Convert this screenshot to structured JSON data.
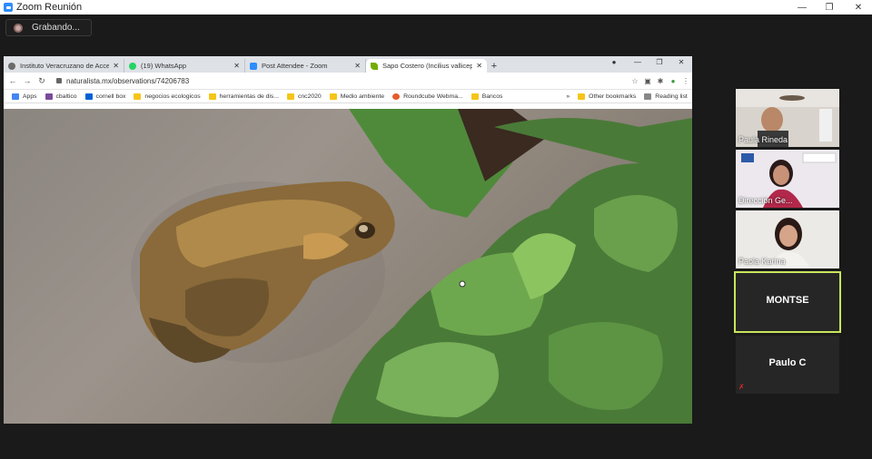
{
  "window": {
    "title": "Zoom Reunión",
    "minimize": "—",
    "restore": "❐",
    "close": "✕"
  },
  "recording": {
    "label": "Grabando..."
  },
  "browser": {
    "tabs": [
      {
        "title": "Instituto Veracruzano de Acceso",
        "favicon_color": "#6b6b6b"
      },
      {
        "title": "(19) WhatsApp",
        "favicon_color": "#25d366"
      },
      {
        "title": "Post Attendee - Zoom",
        "favicon_color": "#2d8cff"
      },
      {
        "title": "Sapo Costero (Incilius valliceps)",
        "favicon_color": "#74ac00"
      }
    ],
    "new_tab": "+",
    "address": "naturalista.mx/observations/74206783",
    "bookmarks": [
      {
        "label": "Apps",
        "color": "#4285f4"
      },
      {
        "label": "cbaltico",
        "color": "#7b4b9b"
      },
      {
        "label": "cornell box",
        "color": "#0061d5"
      },
      {
        "label": "negocios ecologicos",
        "color": "#f5c518"
      },
      {
        "label": "herramientas de dis...",
        "color": "#f5c518"
      },
      {
        "label": "cnc2020",
        "color": "#f5c518"
      },
      {
        "label": "Medio ambiente",
        "color": "#f5c518"
      },
      {
        "label": "Roundcube Webma...",
        "color": "#e55b2b"
      },
      {
        "label": "Bancos",
        "color": "#f5c518"
      }
    ],
    "more": "»",
    "other_bookmarks": "Other bookmarks",
    "reading_list": "Reading list"
  },
  "participants": [
    {
      "name": "Paula Rineda",
      "type": "video",
      "bg": "#cfcac4"
    },
    {
      "name": "Dirección Ge...",
      "type": "video",
      "bg": "#ddd7dd"
    },
    {
      "name": "Paola Karina",
      "type": "video",
      "bg": "#e6e2de"
    },
    {
      "name": "MONTSE",
      "type": "text",
      "speaking": true
    },
    {
      "name": "Paulo C",
      "type": "text",
      "muted": true
    }
  ]
}
